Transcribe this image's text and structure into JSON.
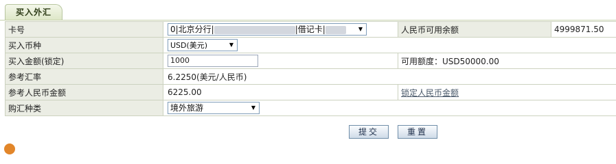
{
  "tab": {
    "label": "买入外汇"
  },
  "form": {
    "card_label": "卡号",
    "card_value_prefix": "0|北京分行|",
    "card_value_mid": "|借记卡|",
    "rmb_balance_label": "人民币可用余额",
    "rmb_balance_value": "4999871.50",
    "currency_label": "买入币种",
    "currency_value": "USD(美元)",
    "amount_label": "买入金额(锁定)",
    "amount_value": "1000",
    "available_quota_text": "可用额度：USD50000.00",
    "rate_label": "参考汇率",
    "rate_value": "6.2250(美元/人民币)",
    "rmb_amount_label": "参考人民币金额",
    "rmb_amount_value": "6225.00",
    "lock_rmb_link": "锁定人民币金额",
    "purchase_type_label": "购汇种类",
    "purchase_type_value": "境外旅游"
  },
  "actions": {
    "submit_label": "提交",
    "reset_label": "重置"
  },
  "icons": {
    "dropdown": "chevron-down-icon"
  },
  "colors": {
    "label_bg": "#ebede4",
    "border": "#ccd2bf",
    "tab_bg": "#dde6c6"
  }
}
